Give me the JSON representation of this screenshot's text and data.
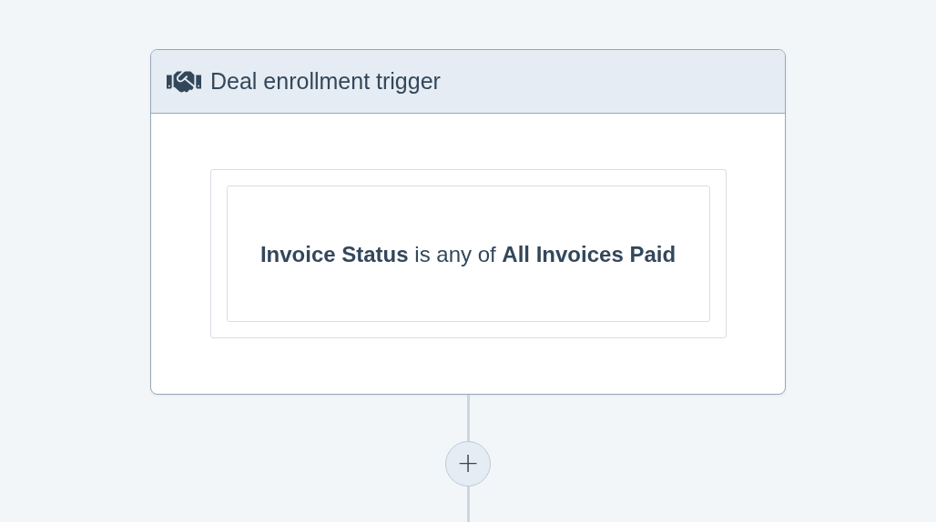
{
  "trigger": {
    "title": "Deal enrollment trigger",
    "condition": "**Invoice Status** is any of **All Invoices Paid**"
  },
  "add_button": {
    "label": "+"
  }
}
